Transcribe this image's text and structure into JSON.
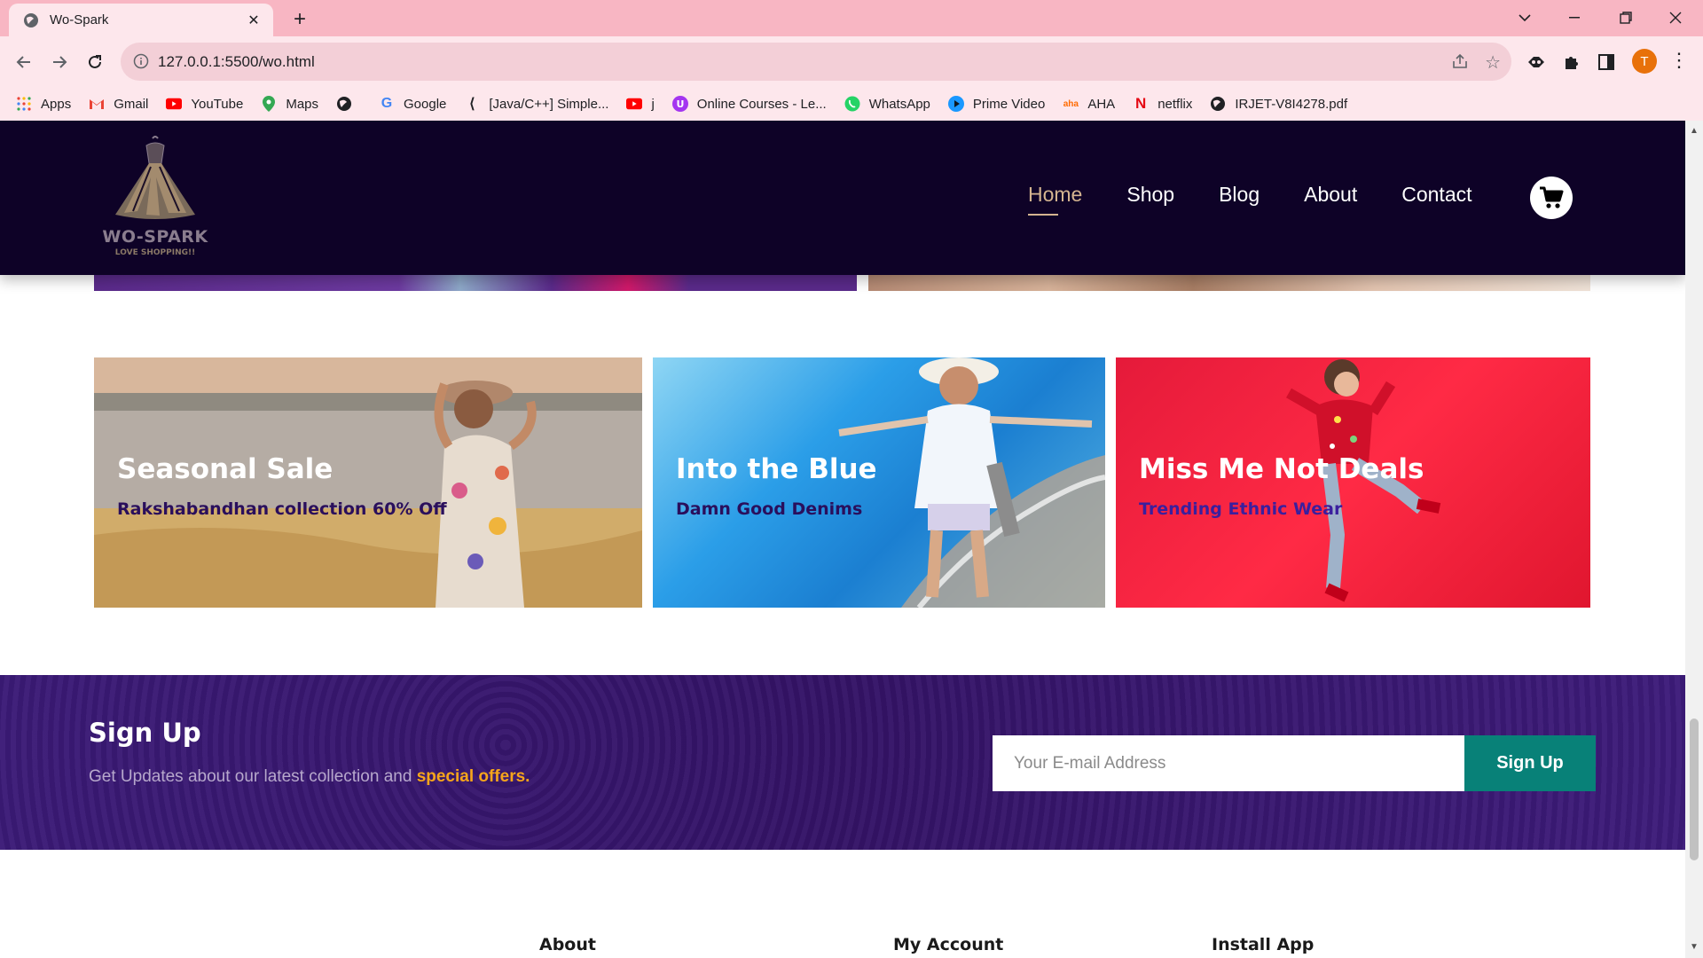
{
  "browser": {
    "tab_title": "Wo-Spark",
    "url": "127.0.0.1:5500/wo.html",
    "profile_initial": "T",
    "bookmarks": [
      {
        "label": "Apps",
        "icon": "apps-grid-icon"
      },
      {
        "label": "Gmail",
        "icon": "gmail-icon"
      },
      {
        "label": "YouTube",
        "icon": "youtube-icon"
      },
      {
        "label": "Maps",
        "icon": "maps-icon"
      },
      {
        "label": "",
        "icon": "globe-icon"
      },
      {
        "label": "Google",
        "icon": "google-icon"
      },
      {
        "label": "[Java/C++] Simple...",
        "icon": "code-icon"
      },
      {
        "label": "j",
        "icon": "youtube-icon"
      },
      {
        "label": "Online Courses - Le...",
        "icon": "udemy-icon"
      },
      {
        "label": "WhatsApp",
        "icon": "whatsapp-icon"
      },
      {
        "label": "Prime Video",
        "icon": "prime-video-icon"
      },
      {
        "label": "AHA",
        "icon": "aha-icon"
      },
      {
        "label": "netflix",
        "icon": "netflix-icon"
      },
      {
        "label": "IRJET-V8I4278.pdf",
        "icon": "globe-icon"
      }
    ]
  },
  "header": {
    "logo_brand": "WO-SPARK",
    "logo_tagline": "LOVE SHOPPING!!",
    "nav": [
      "Home",
      "Shop",
      "Blog",
      "About",
      "Contact"
    ],
    "active_nav": "Home"
  },
  "banners": [
    {
      "title": "Seasonal Sale",
      "subtitle": "Rakshabandhan collection 60% Off"
    },
    {
      "title": "Into the Blue",
      "subtitle": "Damn Good Denims"
    },
    {
      "title": "Miss Me Not Deals",
      "subtitle": "Trending Ethnic Wear"
    }
  ],
  "signup": {
    "title": "Sign Up",
    "text_prefix": "Get Updates about our latest collection and ",
    "text_highlight": "special offers.",
    "email_placeholder": "Your E-mail Address",
    "button_label": "Sign Up"
  },
  "footer": {
    "headings": [
      "About",
      "My Account",
      "Install App"
    ]
  },
  "colors": {
    "header_bg": "#0e0227",
    "nav_active": "#d4b490",
    "signup_bg": "#3a1873",
    "signup_button": "#088178",
    "highlight": "#f6a51b"
  }
}
